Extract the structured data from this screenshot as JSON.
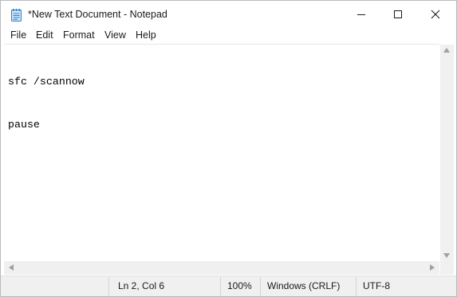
{
  "window": {
    "title": "*New Text Document - Notepad",
    "app_icon": "notepad-icon",
    "controls": {
      "minimize_icon": "minimize-icon",
      "maximize_icon": "maximize-icon",
      "close_icon": "close-icon"
    }
  },
  "menu": {
    "items": [
      {
        "label": "File"
      },
      {
        "label": "Edit"
      },
      {
        "label": "Format"
      },
      {
        "label": "View"
      },
      {
        "label": "Help"
      }
    ]
  },
  "editor": {
    "lines": [
      "sfc /scannow",
      "pause"
    ]
  },
  "status": {
    "position": "Ln 2, Col 6",
    "zoom": "100%",
    "line_ending": "Windows (CRLF)",
    "encoding": "UTF-8"
  },
  "colors": {
    "window_bg": "#ffffff",
    "chrome_bg": "#f0f0f0",
    "icon_accent": "#2a7fd4"
  }
}
